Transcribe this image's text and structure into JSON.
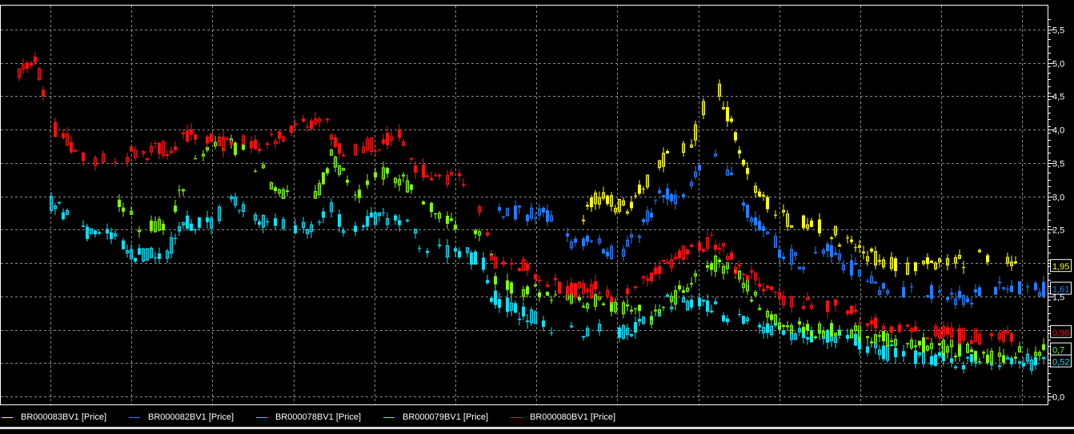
{
  "chart_data": {
    "type": "candlestick",
    "title": "",
    "xlabel": "",
    "ylabel": "Price",
    "ylim": [
      -0.05,
      5.75
    ],
    "y_ticks": [
      "0,0",
      "0,5",
      "1,0",
      "1,5",
      "2,0",
      "2,5",
      "3,0",
      "3,5",
      "4,0",
      "4,5",
      "5,0",
      "5,5"
    ],
    "y_tick_values": [
      0,
      0.5,
      1,
      1.5,
      2,
      2.5,
      3,
      3.5,
      4,
      4.5,
      5,
      5.5
    ],
    "grid": true,
    "legend_position": "bottom",
    "series": [
      {
        "name": "BR000083BV1 [Price]",
        "color": "#ffff00",
        "last_value": "1,95",
        "last": 1.95,
        "anchors": [
          [
            144,
            2.6
          ],
          [
            148,
            3.0
          ],
          [
            156,
            2.8
          ],
          [
            164,
            3.5
          ],
          [
            172,
            3.8
          ],
          [
            178,
            4.8
          ],
          [
            186,
            3.3
          ],
          [
            194,
            2.7
          ],
          [
            200,
            2.6
          ],
          [
            206,
            2.5
          ],
          [
            214,
            2.2
          ],
          [
            220,
            2.0
          ],
          [
            226,
            1.95
          ],
          [
            238,
            2.0
          ],
          [
            246,
            2.1
          ],
          [
            254,
            1.95
          ]
        ]
      },
      {
        "name": "BR000082BV1 [Price]",
        "color": "#1e7fff",
        "last_value": "1,61",
        "last": 1.61,
        "anchors": [
          [
            124,
            2.8
          ],
          [
            136,
            2.7
          ],
          [
            142,
            2.3
          ],
          [
            148,
            2.3
          ],
          [
            154,
            2.1
          ],
          [
            158,
            2.4
          ],
          [
            164,
            3.0
          ],
          [
            170,
            3.0
          ],
          [
            178,
            3.7
          ],
          [
            186,
            2.8
          ],
          [
            194,
            2.2
          ],
          [
            200,
            2.0
          ],
          [
            206,
            2.2
          ],
          [
            215,
            1.8
          ],
          [
            220,
            1.6
          ],
          [
            228,
            1.6
          ],
          [
            236,
            1.5
          ],
          [
            242,
            1.5
          ],
          [
            248,
            1.6
          ],
          [
            260,
            1.61
          ]
        ]
      },
      {
        "name": "BR000078BV1 [Price]",
        "color": "#00e5ff",
        "last_value": "0,52",
        "last": 0.52,
        "anchors": [
          [
            12,
            2.9
          ],
          [
            16,
            2.7
          ],
          [
            22,
            2.4
          ],
          [
            28,
            2.4
          ],
          [
            33,
            2.1
          ],
          [
            40,
            2.1
          ],
          [
            46,
            2.6
          ],
          [
            52,
            2.6
          ],
          [
            57,
            2.9
          ],
          [
            66,
            2.6
          ],
          [
            72,
            2.5
          ],
          [
            78,
            2.5
          ],
          [
            82,
            2.8
          ],
          [
            86,
            2.5
          ],
          [
            94,
            2.7
          ],
          [
            100,
            2.6
          ],
          [
            106,
            2.2
          ],
          [
            114,
            2.2
          ],
          [
            120,
            2.0
          ],
          [
            122,
            1.5
          ],
          [
            128,
            1.3
          ],
          [
            138,
            1.0
          ],
          [
            144,
            1.0
          ],
          [
            154,
            0.95
          ],
          [
            160,
            1.1
          ],
          [
            166,
            1.4
          ],
          [
            174,
            1.4
          ],
          [
            186,
            1.1
          ],
          [
            192,
            1.0
          ],
          [
            200,
            0.9
          ],
          [
            210,
            0.9
          ],
          [
            218,
            0.7
          ],
          [
            226,
            0.6
          ],
          [
            236,
            0.55
          ],
          [
            246,
            0.5
          ],
          [
            260,
            0.52
          ]
        ]
      },
      {
        "name": "BR000079BV1 [Price]",
        "color": "#7fff00",
        "last_value": "0,7",
        "last": 0.7,
        "anchors": [
          [
            28,
            2.9
          ],
          [
            35,
            2.5
          ],
          [
            41,
            2.6
          ],
          [
            48,
            3.5
          ],
          [
            52,
            3.8
          ],
          [
            60,
            3.7
          ],
          [
            70,
            3.0
          ],
          [
            77,
            2.8
          ],
          [
            82,
            3.6
          ],
          [
            88,
            3.0
          ],
          [
            96,
            3.4
          ],
          [
            104,
            3.0
          ],
          [
            110,
            2.7
          ],
          [
            121,
            2.4
          ],
          [
            123,
            1.8
          ],
          [
            128,
            1.6
          ],
          [
            138,
            1.5
          ],
          [
            148,
            1.4
          ],
          [
            156,
            1.3
          ],
          [
            162,
            1.2
          ],
          [
            170,
            1.6
          ],
          [
            178,
            2.0
          ],
          [
            184,
            1.8
          ],
          [
            189,
            1.4
          ],
          [
            194,
            1.1
          ],
          [
            200,
            1.0
          ],
          [
            210,
            1.0
          ],
          [
            218,
            0.9
          ],
          [
            226,
            0.8
          ],
          [
            236,
            0.75
          ],
          [
            246,
            0.6
          ],
          [
            260,
            0.7
          ]
        ]
      },
      {
        "name": "BR000080BV1 [Price]",
        "color": "#ff1010",
        "last_value": "0,96",
        "last": 0.96,
        "anchors": [
          [
            4,
            4.9
          ],
          [
            8,
            5.0
          ],
          [
            13,
            4.0
          ],
          [
            22,
            3.5
          ],
          [
            30,
            3.6
          ],
          [
            40,
            3.7
          ],
          [
            46,
            3.9
          ],
          [
            54,
            3.8
          ],
          [
            66,
            3.8
          ],
          [
            80,
            4.2
          ],
          [
            84,
            3.7
          ],
          [
            94,
            3.8
          ],
          [
            99,
            3.9
          ],
          [
            102,
            3.5
          ],
          [
            108,
            3.3
          ],
          [
            114,
            3.3
          ],
          [
            120,
            2.8
          ],
          [
            122,
            2.0
          ],
          [
            130,
            2.0
          ],
          [
            140,
            1.6
          ],
          [
            148,
            1.6
          ],
          [
            154,
            1.5
          ],
          [
            160,
            1.7
          ],
          [
            166,
            2.0
          ],
          [
            172,
            2.2
          ],
          [
            177,
            2.3
          ],
          [
            180,
            2.2
          ],
          [
            185,
            1.8
          ],
          [
            190,
            1.7
          ],
          [
            196,
            1.4
          ],
          [
            204,
            1.4
          ],
          [
            210,
            1.3
          ],
          [
            214,
            1.2
          ],
          [
            220,
            1.0
          ],
          [
            226,
            0.96
          ],
          [
            232,
            0.95
          ],
          [
            240,
            0.9
          ],
          [
            246,
            0.9
          ],
          [
            254,
            0.96
          ]
        ]
      }
    ]
  }
}
